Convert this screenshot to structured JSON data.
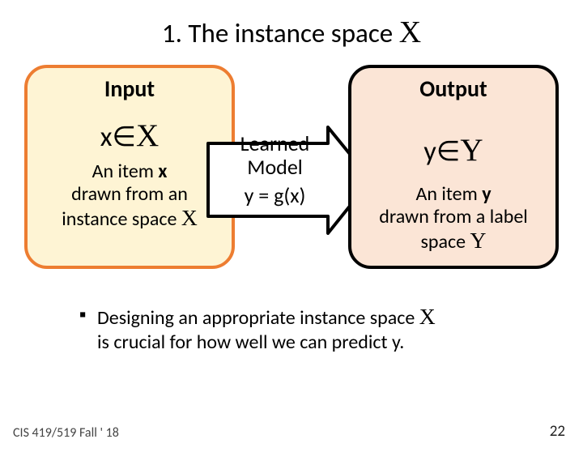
{
  "title_prefix": "1. The instance space ",
  "title_symbol": "X",
  "input": {
    "head": "Input",
    "line_prefix": "x∈",
    "line_symbol": "X",
    "desc_l1_a": "An item ",
    "desc_l1_b": "x",
    "desc_l2": "drawn from an",
    "desc_l3_a": "instance space ",
    "desc_l3_b": "X"
  },
  "arrow": {
    "l1": "Learned",
    "l2": "Model",
    "eq": "y = g(x)"
  },
  "output": {
    "head": "Output",
    "line_prefix": "y∈",
    "line_symbol": "Y",
    "desc_l1_a": "An item ",
    "desc_l1_b": "y",
    "desc_l2": "drawn from a label",
    "desc_l3_a": "space ",
    "desc_l3_b": "Y"
  },
  "bullet": {
    "marker": "▪",
    "t1": "Designing an appropriate instance space ",
    "t1_sym": "X",
    "t2": "is crucial for how well we can predict y."
  },
  "footer": "CIS 419/519 Fall ' 18",
  "pagenum": "22"
}
